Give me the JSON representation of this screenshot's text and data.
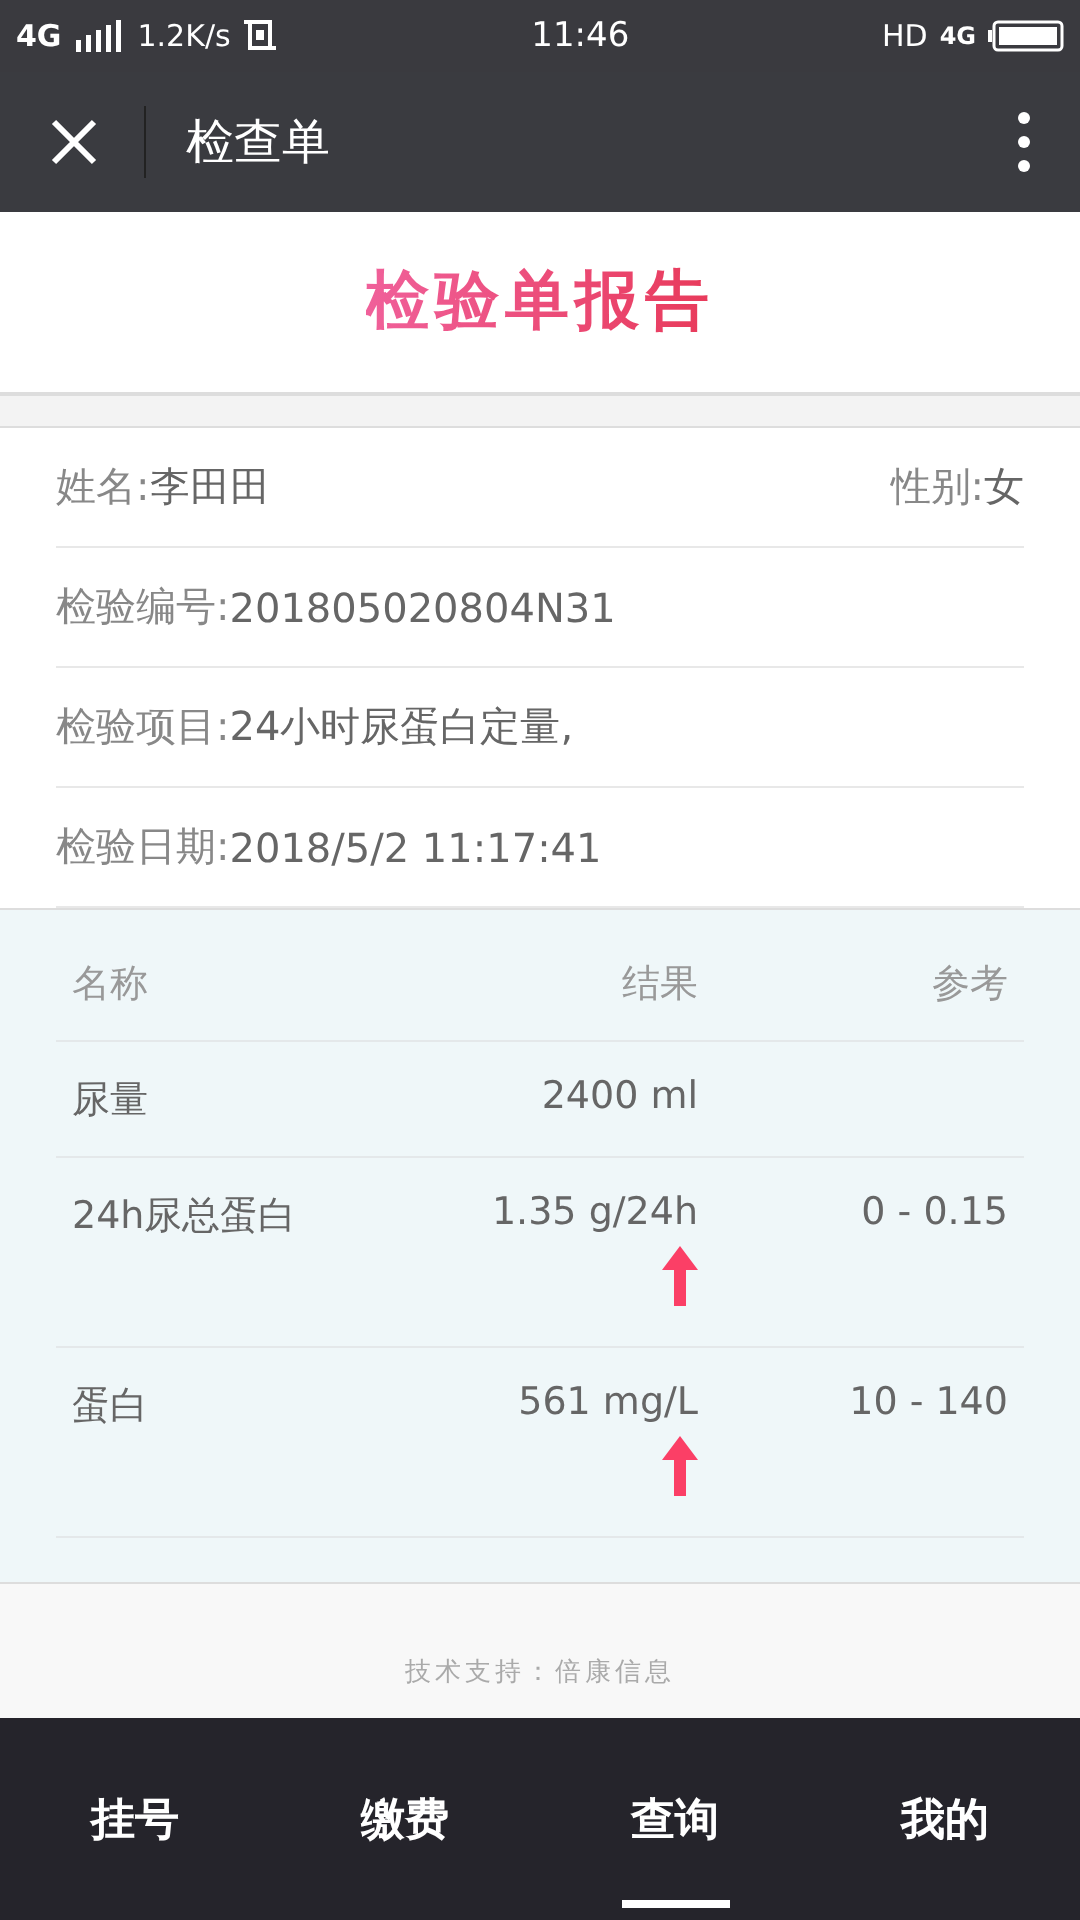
{
  "status_bar": {
    "network": "4G",
    "speed": "1.2K/s",
    "time": "11:46",
    "hd": "HD",
    "network_right": "4G"
  },
  "toolbar": {
    "title": "检查单"
  },
  "header": {
    "title": "检验单报告"
  },
  "patient": [
    {
      "label": "姓名:",
      "value": "李田田",
      "side_label": "性别:",
      "side_value": "女"
    },
    {
      "label": "检验编号:",
      "value": "201805020804N31"
    },
    {
      "label": "检验项目:",
      "value": "24小时尿蛋白定量,"
    },
    {
      "label": "检验日期:",
      "value": "2018/5/2 11:17:41"
    }
  ],
  "table": {
    "columns": [
      "名称",
      "结果",
      "参考"
    ],
    "rows": [
      {
        "name": "尿量",
        "result": "2400 ml",
        "reference": "",
        "high": false
      },
      {
        "name": "24h尿总蛋白",
        "result": "1.35 g/24h",
        "reference": "0 - 0.15",
        "high": true
      },
      {
        "name": "蛋白",
        "result": "561 mg/L",
        "reference": "10 - 140",
        "high": true
      }
    ]
  },
  "footer": "技术支持：倍康信息",
  "tabs": [
    {
      "label": "挂号",
      "selected": false
    },
    {
      "label": "缴费",
      "selected": false
    },
    {
      "label": "查询",
      "selected": true
    },
    {
      "label": "我的",
      "selected": false
    }
  ]
}
